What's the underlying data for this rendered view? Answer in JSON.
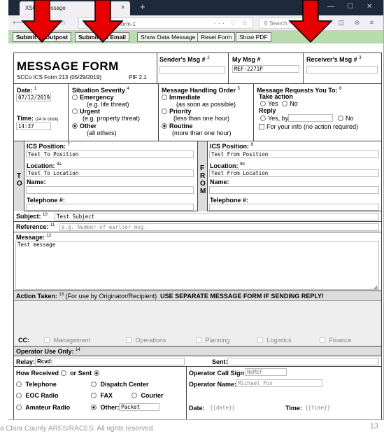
{
  "browser": {
    "tab_title": "XSC... Message",
    "url": "0.1:56003/form-1",
    "url_dots": "··· ♡ ☆",
    "search_placeholder": "Search",
    "tools": "|||\\ ◫ ⊛ ≡"
  },
  "toolbar": {
    "submit_outpost": "Submit to Outpost",
    "submit_email": "Submit via Email",
    "show_data": "Show Data Message",
    "reset": "Reset Form",
    "show_pdf": "Show PDF"
  },
  "header": {
    "title": "MESSAGE FORM",
    "subtitle": "SCCo ICS Form 213 (05/29/2019)",
    "pif": "PIF 2.1",
    "senders_msg": "Sender's Msg #",
    "senders_sup": "2",
    "my_msg": "My Msg #",
    "my_msg_value": "MEF-2271P",
    "receivers_msg": "Receiver's Msg #",
    "receivers_sup": "3"
  },
  "row1": {
    "date_label": "Date:",
    "date_sup": "1",
    "date_value": "07/12/2019",
    "time_label": "Time:",
    "time_note": "(24 hr clock)",
    "time_value": "14:37",
    "severity_label": "Situation Severity",
    "severity_sup": "4",
    "sev_emergency": "Emergency",
    "sev_emergency_note": "(e.g. life threat)",
    "sev_urgent": "Urgent",
    "sev_urgent_note": "(e.g. property threat)",
    "sev_other": "Other",
    "sev_other_note": "(all others)",
    "handling_label": "Message Handling Order",
    "handling_sup": "5",
    "h_immediate": "Immediate",
    "h_immediate_note": "(as soon as possible)",
    "h_priority": "Priority",
    "h_priority_note": "(less than one hour)",
    "h_routine": "Routine",
    "h_routine_note": "(more than one hour)",
    "requests_label": "Message Requests You To:",
    "requests_sup": "6",
    "take_action": "Take action",
    "yes": "Yes",
    "no": "No",
    "reply": "Reply",
    "yes_by": "Yes, by",
    "fyi": "For your info (no action required)"
  },
  "to": {
    "letters": [
      "T",
      "O"
    ],
    "ics_label": "ICS Position:",
    "ics_sup": "7",
    "ics_value": "Test To Position",
    "loc_label": "Location:",
    "loc_sup": "9a",
    "loc_value": "Test To Location",
    "name_label": "Name:",
    "tel_label": "Telephone #:"
  },
  "from": {
    "letters": [
      "F",
      "R",
      "O",
      "M"
    ],
    "ics_label": "ICS Position:",
    "ics_sup": "8",
    "ics_value": "Test From Position",
    "loc_label": "Location:",
    "loc_sup": "9b",
    "loc_value": "Test From Location",
    "name_label": "Name:",
    "tel_label": "Telephone #:"
  },
  "subject": {
    "label": "Subject:",
    "sup": "10",
    "value": "Test Subject"
  },
  "reference": {
    "label": "Reference:",
    "sup": "11",
    "placeholder": "e.g. Number of earlier msg."
  },
  "message": {
    "label": "Message:",
    "sup": "12",
    "value": "Test message"
  },
  "action": {
    "label": "Action Taken:",
    "sup": "13",
    "note": "(For use by Originator/Recipient)",
    "warning": "USE SEPARATE MESSAGE FORM IF SENDING REPLY!"
  },
  "cc": {
    "label": "CC:",
    "items": [
      "Management",
      "Operations",
      "Planning",
      "Logistics",
      "Finance"
    ]
  },
  "operator": {
    "label": "Operator Use Only:",
    "sup": "14",
    "relay_label": "Relay:",
    "rcvd_label": "Rcvd:",
    "sent_label": "Sent:",
    "how_received": "How Received",
    "or_sent": "or Sent",
    "telephone": "Telephone",
    "dispatch": "Dispatch Center",
    "eoc": "EOC Radio",
    "fax": "FAX",
    "courier": "Courier",
    "amateur": "Amateur Radio",
    "other": "Other:",
    "other_value": "Packet",
    "call_sign_label": "Operator Call Sign:",
    "call_sign_value": "N6MEF",
    "name_label": "Operator Name:",
    "name_value": "Michael Fox",
    "date_label": "Date:",
    "date_value": "{{date}}",
    "time_label": "Time:",
    "time_value": "{{time}}"
  },
  "footer": {
    "copyright": "a Clara County ARES/RACES.  All rights reserved.",
    "page": "13"
  },
  "colors": {
    "toolbar_bg": "#b9dcae",
    "arrow": "#e60000",
    "titlebar": "#1c2a3c"
  }
}
